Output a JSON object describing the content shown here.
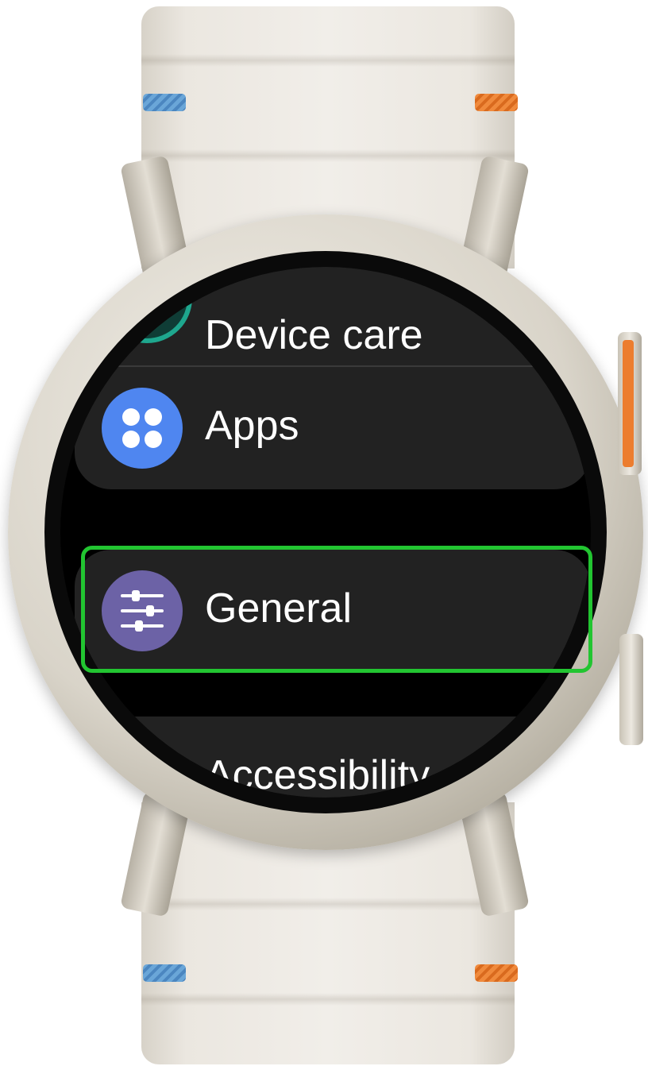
{
  "device": {
    "type": "smartwatch",
    "band_color": "#eeebe5",
    "case_color": "#d9d4c9",
    "accent_colors": [
      "#4b86c0",
      "#ec7d2f"
    ]
  },
  "settings_list": {
    "items": [
      {
        "id": "device-care",
        "label": "Device care",
        "icon": "device-care-icon",
        "icon_color": "#1ea78e"
      },
      {
        "id": "apps",
        "label": "Apps",
        "icon": "apps-icon",
        "icon_color": "#4f86f0"
      },
      {
        "id": "general",
        "label": "General",
        "icon": "sliders-icon",
        "icon_color": "#6c62a6",
        "highlighted": true
      },
      {
        "id": "accessibility",
        "label": "Accessibility",
        "icon": "accessibility-icon",
        "icon_color": "#3ea553"
      }
    ]
  },
  "highlight": {
    "target": "General",
    "color": "#22c531"
  }
}
